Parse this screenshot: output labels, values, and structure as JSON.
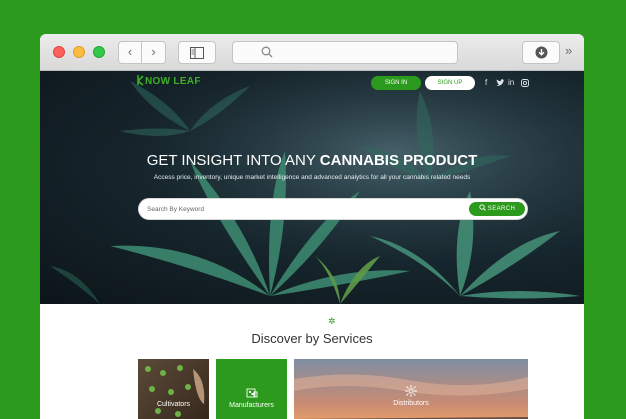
{
  "browser": {
    "back": "‹",
    "forward": "›",
    "overflow": "»"
  },
  "header": {
    "logo_text": "NOW LEAF",
    "signin": "SIGN IN",
    "signup": "SIGN UP",
    "social": [
      "f",
      "t",
      "in",
      "ig"
    ]
  },
  "hero": {
    "title_light": "GET INSIGHT INTO ANY ",
    "title_bold": "CANNABIS PRODUCT",
    "subtitle": "Access price, inventory, unique market intelligence and advanced analytics for all your cannabis related needs",
    "search_placeholder": "Search By Keyword",
    "search_button": "SEARCH"
  },
  "services": {
    "heading": "Discover by Services",
    "cards": [
      {
        "label": "Cultivators"
      },
      {
        "label": "Manufacturers"
      },
      {
        "label": "Distributors"
      }
    ]
  },
  "colors": {
    "brand_green": "#2c9a1c",
    "backdrop": "#2c9a1c"
  }
}
